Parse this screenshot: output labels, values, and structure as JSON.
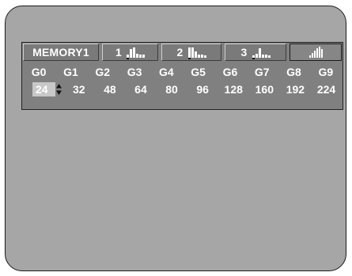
{
  "tabs": [
    {
      "label": "MEMORY1",
      "selected": false
    },
    {
      "number": "1",
      "icon": "gamma-curve-1-icon"
    },
    {
      "number": "2",
      "icon": "gamma-curve-2-icon"
    },
    {
      "number": "3",
      "icon": "gamma-curve-3-icon"
    },
    {
      "icon": "gamma-curve-custom-icon",
      "selected": true
    }
  ],
  "gamma": {
    "headers": [
      "G0",
      "G1",
      "G2",
      "G3",
      "G4",
      "G5",
      "G6",
      "G7",
      "G8",
      "G9"
    ],
    "values": [
      "24",
      "32",
      "48",
      "64",
      "80",
      "96",
      "128",
      "160",
      "192",
      "224"
    ],
    "active_index": 0
  }
}
